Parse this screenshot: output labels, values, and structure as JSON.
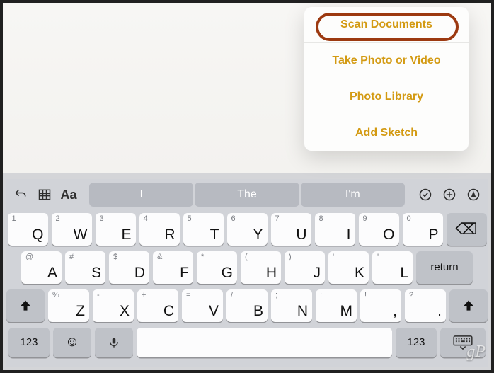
{
  "popover": {
    "items": [
      {
        "label": "Scan Documents"
      },
      {
        "label": "Take Photo or Video"
      },
      {
        "label": "Photo Library"
      },
      {
        "label": "Add Sketch"
      }
    ],
    "highlighted_index": 0
  },
  "keyboard": {
    "suggestions": [
      "I",
      "The",
      "I'm"
    ],
    "rows": [
      [
        {
          "alt": "1",
          "main": "Q"
        },
        {
          "alt": "2",
          "main": "W"
        },
        {
          "alt": "3",
          "main": "E"
        },
        {
          "alt": "4",
          "main": "R"
        },
        {
          "alt": "5",
          "main": "T"
        },
        {
          "alt": "6",
          "main": "Y"
        },
        {
          "alt": "7",
          "main": "U"
        },
        {
          "alt": "8",
          "main": "I"
        },
        {
          "alt": "9",
          "main": "O"
        },
        {
          "alt": "0",
          "main": "P"
        }
      ],
      [
        {
          "alt": "@",
          "main": "A"
        },
        {
          "alt": "#",
          "main": "S"
        },
        {
          "alt": "$",
          "main": "D"
        },
        {
          "alt": "&",
          "main": "F"
        },
        {
          "alt": "*",
          "main": "G"
        },
        {
          "alt": "(",
          "main": "H"
        },
        {
          "alt": ")",
          "main": "J"
        },
        {
          "alt": "'",
          "main": "K"
        },
        {
          "alt": "\"",
          "main": "L"
        }
      ],
      [
        {
          "alt": "%",
          "main": "Z"
        },
        {
          "alt": "-",
          "main": "X"
        },
        {
          "alt": "+",
          "main": "C"
        },
        {
          "alt": "=",
          "main": "V"
        },
        {
          "alt": "/",
          "main": "B"
        },
        {
          "alt": ";",
          "main": "N"
        },
        {
          "alt": ":",
          "main": "M"
        },
        {
          "alt": "!",
          "main": ","
        },
        {
          "alt": "?",
          "main": "."
        }
      ]
    ],
    "return_label": "return",
    "number_switch_label": "123"
  },
  "watermark": "gP"
}
